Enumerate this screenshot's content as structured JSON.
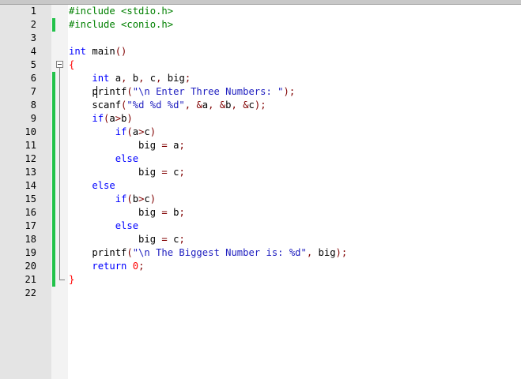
{
  "editor": {
    "lines": [
      {
        "num": "1",
        "changed": false,
        "tokens": [
          {
            "t": "#include <stdio.h>",
            "c": "pp"
          }
        ]
      },
      {
        "num": "2",
        "changed": true,
        "tokens": [
          {
            "t": "#include <conio.h>",
            "c": "pp"
          }
        ]
      },
      {
        "num": "3",
        "changed": false,
        "tokens": []
      },
      {
        "num": "4",
        "changed": false,
        "tokens": [
          {
            "t": "int",
            "c": "kw"
          },
          {
            "t": " main"
          },
          {
            "t": "()",
            "c": "op"
          }
        ]
      },
      {
        "num": "5",
        "changed": false,
        "fold": true,
        "tokens": [
          {
            "t": "{",
            "c": "br"
          }
        ]
      },
      {
        "num": "6",
        "changed": true,
        "tokens": [
          {
            "t": "    "
          },
          {
            "t": "int",
            "c": "kw"
          },
          {
            "t": " a"
          },
          {
            "t": ",",
            "c": "op"
          },
          {
            "t": " b"
          },
          {
            "t": ",",
            "c": "op"
          },
          {
            "t": " c"
          },
          {
            "t": ",",
            "c": "op"
          },
          {
            "t": " big"
          },
          {
            "t": ";",
            "c": "op"
          }
        ]
      },
      {
        "num": "7",
        "changed": true,
        "tokens": [
          {
            "t": "    printf"
          },
          {
            "t": "(",
            "c": "op"
          },
          {
            "t": "\"\\n Enter Three Numbers: \"",
            "c": "str"
          },
          {
            "t": ");",
            "c": "op"
          }
        ]
      },
      {
        "num": "8",
        "changed": true,
        "tokens": [
          {
            "t": "    scanf"
          },
          {
            "t": "(",
            "c": "op"
          },
          {
            "t": "\"%d %d %d\"",
            "c": "str"
          },
          {
            "t": ",",
            "c": "op"
          },
          {
            "t": " "
          },
          {
            "t": "&",
            "c": "op"
          },
          {
            "t": "a"
          },
          {
            "t": ",",
            "c": "op"
          },
          {
            "t": " "
          },
          {
            "t": "&",
            "c": "op"
          },
          {
            "t": "b"
          },
          {
            "t": ",",
            "c": "op"
          },
          {
            "t": " "
          },
          {
            "t": "&",
            "c": "op"
          },
          {
            "t": "c"
          },
          {
            "t": ");",
            "c": "op"
          }
        ]
      },
      {
        "num": "9",
        "changed": true,
        "tokens": [
          {
            "t": "    "
          },
          {
            "t": "if",
            "c": "kw"
          },
          {
            "t": "(",
            "c": "op"
          },
          {
            "t": "a"
          },
          {
            "t": ">",
            "c": "op"
          },
          {
            "t": "b"
          },
          {
            "t": ")",
            "c": "op"
          }
        ]
      },
      {
        "num": "10",
        "changed": true,
        "tokens": [
          {
            "t": "        "
          },
          {
            "t": "if",
            "c": "kw"
          },
          {
            "t": "(",
            "c": "op"
          },
          {
            "t": "a"
          },
          {
            "t": ">",
            "c": "op"
          },
          {
            "t": "c"
          },
          {
            "t": ")",
            "c": "op"
          }
        ]
      },
      {
        "num": "11",
        "changed": true,
        "tokens": [
          {
            "t": "            big "
          },
          {
            "t": "=",
            "c": "op"
          },
          {
            "t": " a"
          },
          {
            "t": ";",
            "c": "op"
          }
        ]
      },
      {
        "num": "12",
        "changed": true,
        "tokens": [
          {
            "t": "        "
          },
          {
            "t": "else",
            "c": "kw"
          }
        ]
      },
      {
        "num": "13",
        "changed": true,
        "tokens": [
          {
            "t": "            big "
          },
          {
            "t": "=",
            "c": "op"
          },
          {
            "t": " c"
          },
          {
            "t": ";",
            "c": "op"
          }
        ]
      },
      {
        "num": "14",
        "changed": true,
        "tokens": [
          {
            "t": "    "
          },
          {
            "t": "else",
            "c": "kw"
          }
        ]
      },
      {
        "num": "15",
        "changed": true,
        "tokens": [
          {
            "t": "        "
          },
          {
            "t": "if",
            "c": "kw"
          },
          {
            "t": "(",
            "c": "op"
          },
          {
            "t": "b"
          },
          {
            "t": ">",
            "c": "op"
          },
          {
            "t": "c"
          },
          {
            "t": ")",
            "c": "op"
          }
        ]
      },
      {
        "num": "16",
        "changed": true,
        "tokens": [
          {
            "t": "            big "
          },
          {
            "t": "=",
            "c": "op"
          },
          {
            "t": " b"
          },
          {
            "t": ";",
            "c": "op"
          }
        ]
      },
      {
        "num": "17",
        "changed": true,
        "tokens": [
          {
            "t": "        "
          },
          {
            "t": "else",
            "c": "kw"
          }
        ]
      },
      {
        "num": "18",
        "changed": true,
        "tokens": [
          {
            "t": "            big "
          },
          {
            "t": "=",
            "c": "op"
          },
          {
            "t": " c"
          },
          {
            "t": ";",
            "c": "op"
          }
        ]
      },
      {
        "num": "19",
        "changed": true,
        "tokens": [
          {
            "t": "    printf"
          },
          {
            "t": "(",
            "c": "op"
          },
          {
            "t": "\"\\n The Biggest Number is: %d\"",
            "c": "str"
          },
          {
            "t": ",",
            "c": "op"
          },
          {
            "t": " big"
          },
          {
            "t": ");",
            "c": "op"
          }
        ]
      },
      {
        "num": "20",
        "changed": true,
        "tokens": [
          {
            "t": "    "
          },
          {
            "t": "return",
            "c": "kw"
          },
          {
            "t": " "
          },
          {
            "t": "0",
            "c": "num"
          },
          {
            "t": ";",
            "c": "op"
          }
        ]
      },
      {
        "num": "21",
        "changed": true,
        "tokens": [
          {
            "t": "}",
            "c": "br"
          }
        ]
      },
      {
        "num": "22",
        "changed": false,
        "tokens": []
      }
    ]
  },
  "colors": {
    "keyword": "#0000ff",
    "preprocessor": "#008000",
    "operator": "#800000",
    "brace": "#ff0000",
    "string": "#2020c0",
    "change_marker": "#22c24a"
  }
}
